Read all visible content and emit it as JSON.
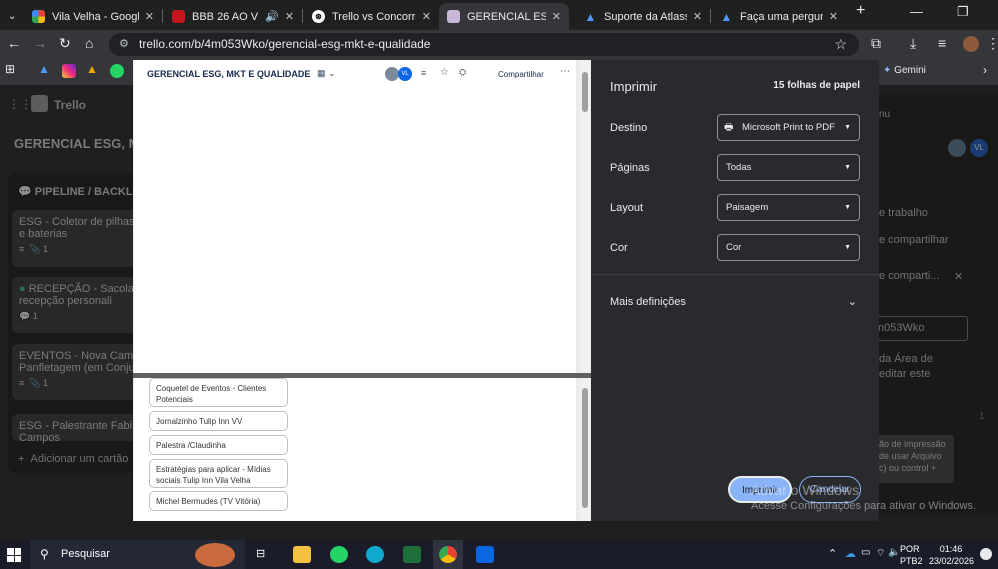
{
  "browser": {
    "tabs": [
      {
        "title": "Vila Velha - Google F",
        "active": false
      },
      {
        "title": "BBB 26 AO VIVO",
        "active": false
      },
      {
        "title": "Trello vs Concorrente",
        "active": false
      },
      {
        "title": "GERENCIAL ESG, MKT",
        "active": true
      },
      {
        "title": "Suporte da Atlassian",
        "active": false
      },
      {
        "title": "Faça uma pergunta -",
        "active": false
      }
    ],
    "url": "trello.com/b/4m053Wko/gerencial-esg-mkt-e-qualidade",
    "gemini_label": "Gemini"
  },
  "trello_bg": {
    "brand": "Trello",
    "board_title": "GERENCIAL ESG, MK",
    "list_title": "PIPELINE / BACKLO",
    "cards": [
      {
        "text": "ESG - Coletor de pilhas e baterias",
        "attachments": "1"
      },
      {
        "text": "RECEPÇÃO - Sacola recepção personali",
        "comments": "1"
      },
      {
        "text": "EVENTOS - Nova Camp Panfletagem (em Conju",
        "attachments": "1"
      },
      {
        "text": "ESG - Palestrante Fabi Campos"
      }
    ],
    "add_card": "Adicionar um cartão",
    "share_panel": [
      "e trabalho",
      "e compartilhar",
      "e comparti...",
      "n053Wko",
      "da Área de",
      "editar este",
      "ão de impressão",
      "de usar Arquivo",
      "c) ou control +"
    ],
    "tab_badge": "nu",
    "num": "1"
  },
  "preview": {
    "board_title": "GERENCIAL ESG, MKT E QUALIDADE",
    "share": "Compartilhar",
    "avatar_initials": "VL",
    "cards": [
      "Coquetel de Eventos - Clientes Potenciais",
      "Jornalzinho Tulip Inn VV",
      "Palestra /Claudinha",
      "Estratégias para aplicar - Mídias sociais Tulip Inn Vila Velha",
      "Michel Bermudes (TV Vitória)"
    ]
  },
  "print_dialog": {
    "title": "Imprimir",
    "sheets": "15 folhas de papel",
    "fields": [
      {
        "label": "Destino",
        "value": "Microsoft Print to PDF"
      },
      {
        "label": "Páginas",
        "value": "Todas"
      },
      {
        "label": "Layout",
        "value": "Paisagem"
      },
      {
        "label": "Cor",
        "value": "Cor"
      }
    ],
    "more_settings": "Mais definições",
    "print_button": "Imprimir",
    "cancel_button": "Cancelar"
  },
  "watermark": {
    "line1": "Ativar o Windows",
    "line2": "Acesse Configurações para ativar o Windows."
  },
  "taskbar": {
    "search": "Pesquisar",
    "lang": "POR",
    "kb": "PTB2",
    "time": "01:46",
    "date": "23/02/2026"
  },
  "colors": {
    "accent": "#8ab4f8",
    "trello_blue": "#0c66e4"
  }
}
